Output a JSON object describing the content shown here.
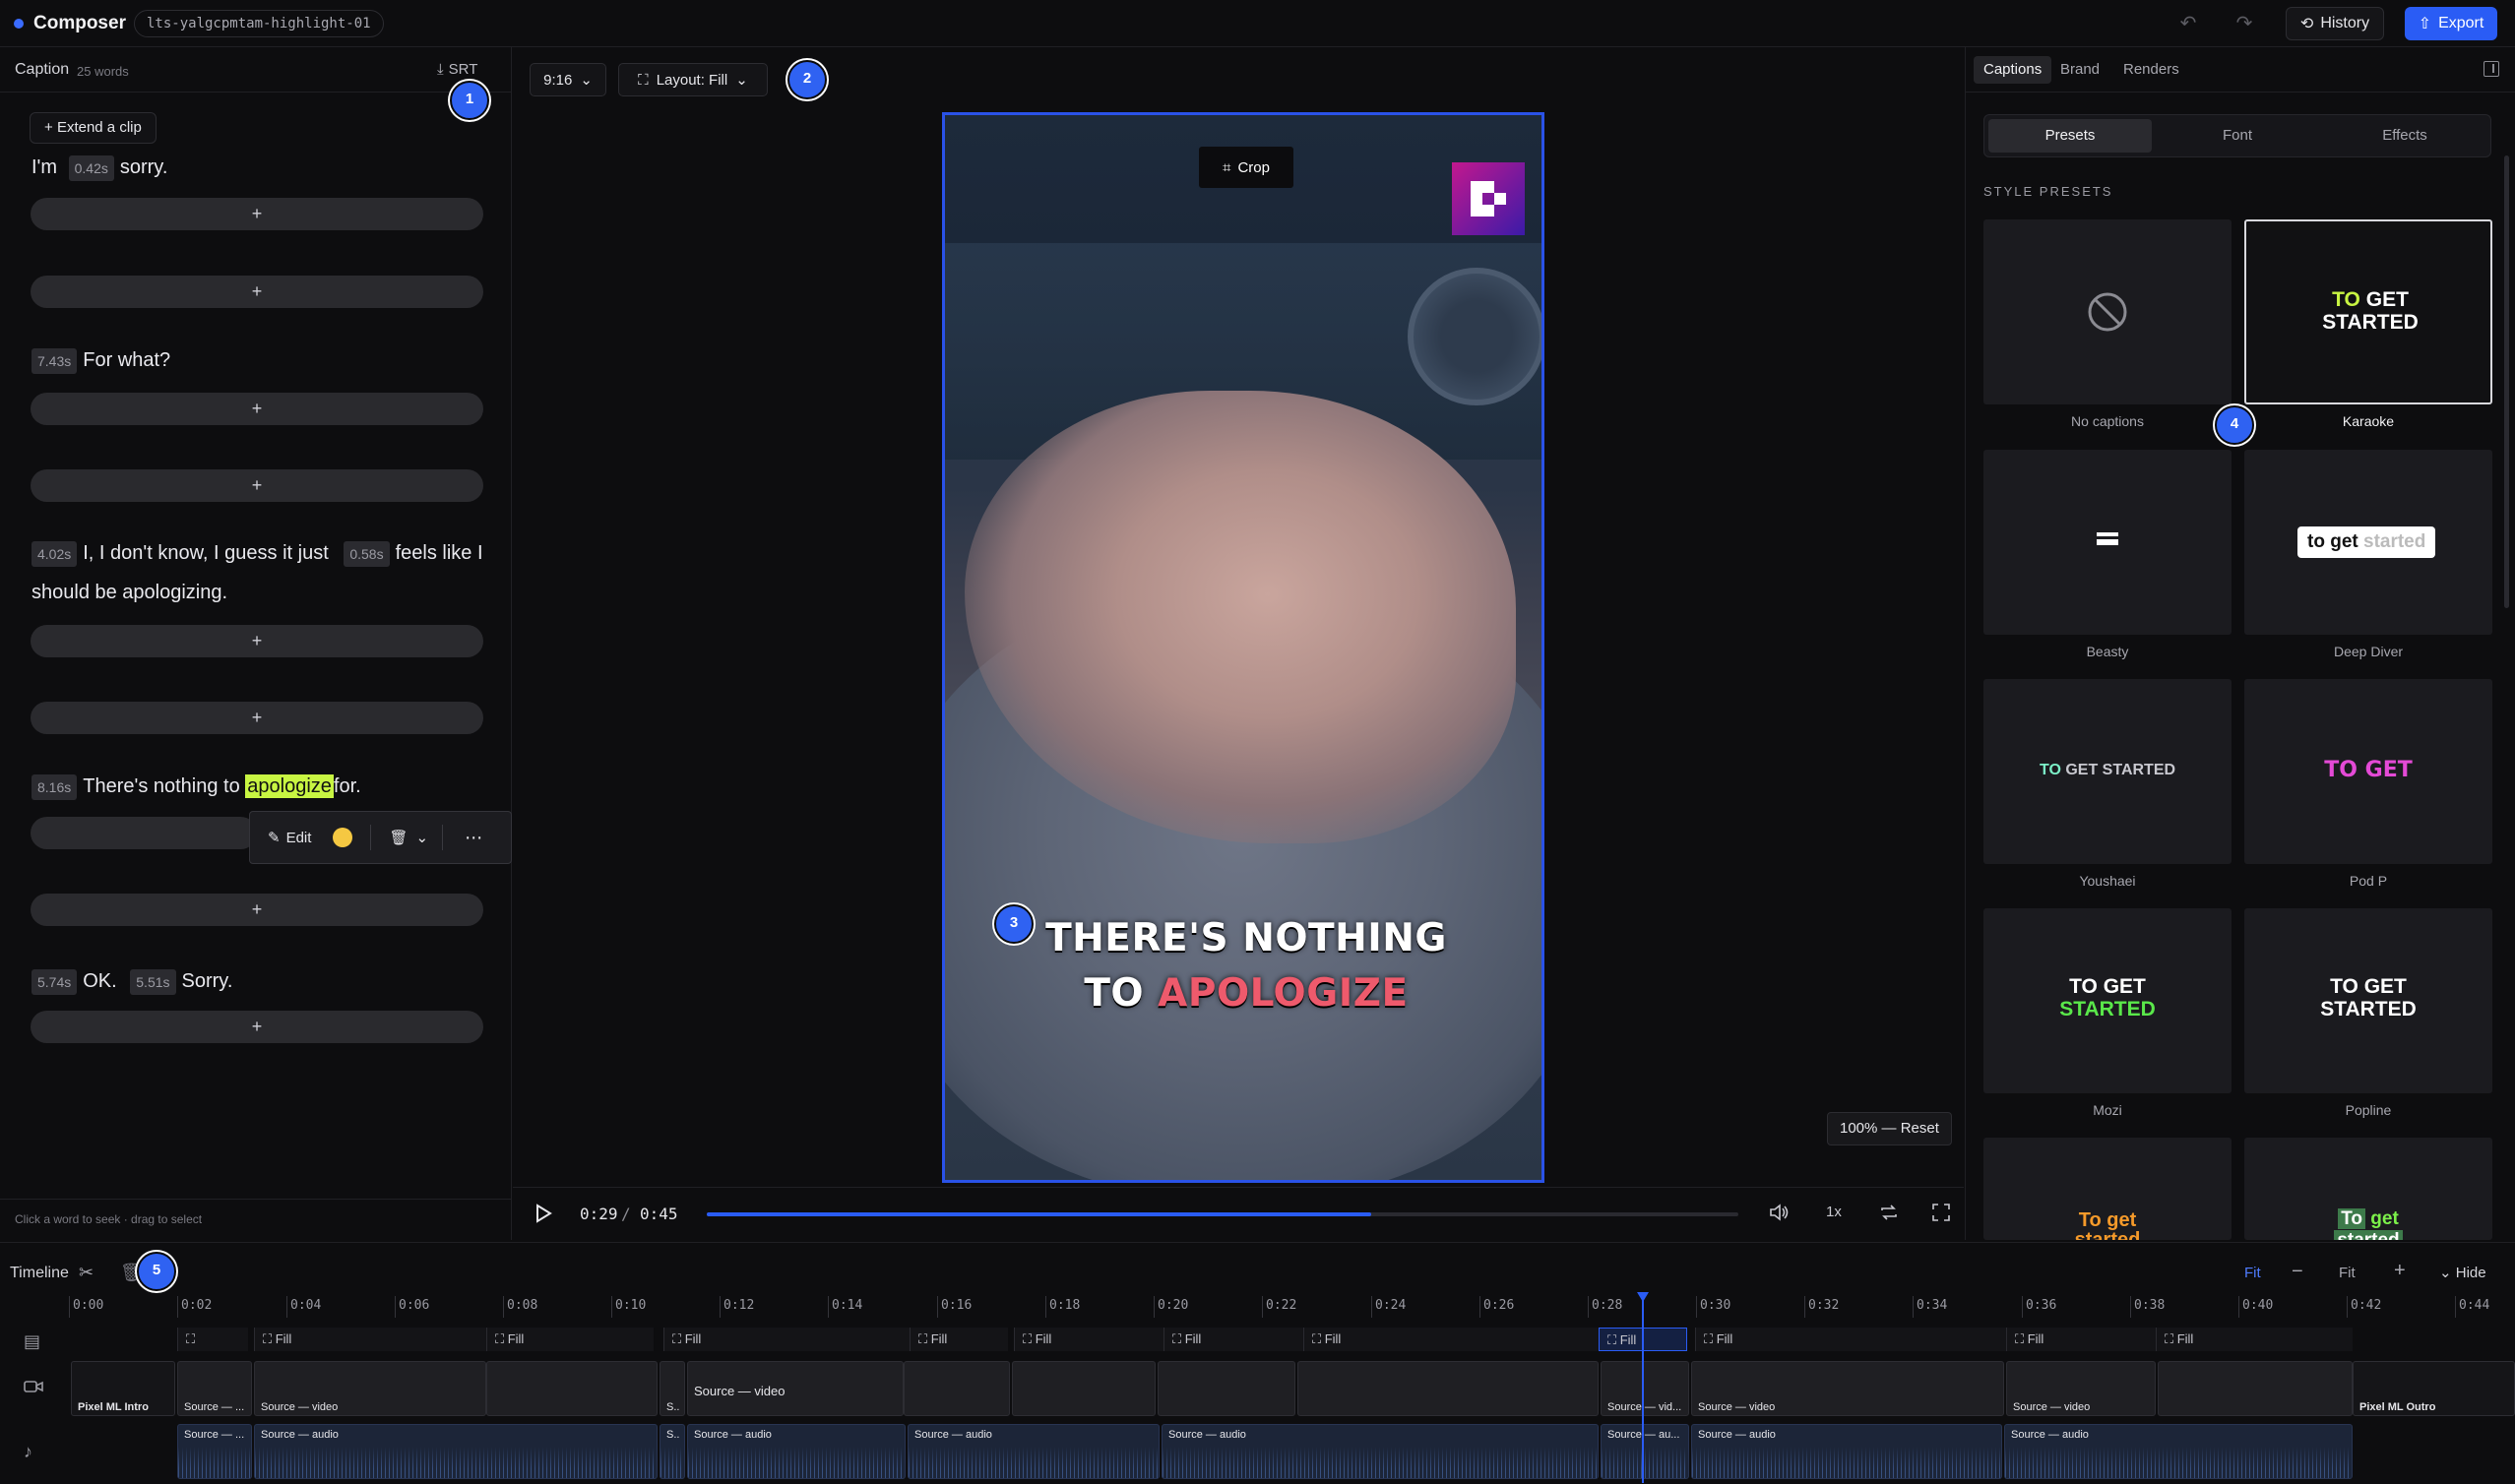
{
  "app": {
    "brand": "Composer",
    "project_id": "lts-yalgcpmtam-highlight-01",
    "history_label": "History",
    "export_label": "Export",
    "accent": "#2a5cf5"
  },
  "caption_panel": {
    "title": "Caption",
    "word_count": "25 words",
    "srt_label": "SRT",
    "extend_label": "Extend a clip",
    "add_symbol": "+",
    "footer_hint": "Click a word to seek · drag to select",
    "lines": [
      {
        "ts1": "0.42s",
        "text_a": "I'm",
        "text_b": "sorry."
      },
      {
        "ts1": "7.43s",
        "text_a": "For what?"
      },
      {
        "ts1": "4.02s",
        "text_a": "I, I don't know, I guess it just",
        "ts2": "0.58s",
        "text_b": "feels like I should be apologizing."
      },
      {
        "ts1": "8.16s",
        "text_a": "There's nothing to",
        "highlight": "apologize",
        "text_b": "for."
      },
      {
        "ts1": "5.74s",
        "text_a": "OK.",
        "ts2": "5.51s",
        "text_b": "Sorry."
      }
    ],
    "word_toolbar": {
      "edit_label": "Edit",
      "color": "#f5c842"
    }
  },
  "stage": {
    "aspect_ratio": "9:16",
    "layout_label": "Layout: Fill",
    "crop_label": "Crop",
    "subtitle_line1": "THERE'S NOTHING",
    "subtitle_line2_a": "TO",
    "subtitle_line2_b": "APOLOGIZE",
    "zoom_reset_label": "100% — Reset",
    "time_current": "0:29",
    "time_separator": "/",
    "time_total": "0:45",
    "progress_fraction": 0.644,
    "speed_label": "1x"
  },
  "style_panel": {
    "tabs": [
      "Captions",
      "Brand",
      "Renders"
    ],
    "active_tab": "Captions",
    "subtabs": [
      "Presets",
      "Font",
      "Effects"
    ],
    "active_subtab": "Presets",
    "section_title": "STYLE PRESETS",
    "presets": [
      {
        "name": "No captions"
      },
      {
        "name": "Karaoke",
        "selected": true,
        "preview_a": "TO",
        "preview_b": "GET",
        "preview_c": "STARTED"
      },
      {
        "name": "Beasty"
      },
      {
        "name": "Deep Diver",
        "preview_a": "to get",
        "preview_b": "started"
      },
      {
        "name": "Youshaei",
        "preview_a": "TO",
        "preview_b": "GET STARTED"
      },
      {
        "name": "Pod P",
        "preview_a": "TO GET"
      },
      {
        "name": "Mozi",
        "preview_a": "TO GET",
        "preview_b": "STARTED"
      },
      {
        "name": "Popline",
        "preview_a": "TO GET",
        "preview_b": "STARTED"
      },
      {
        "name": "",
        "preview_a": "To get",
        "preview_b": "started"
      },
      {
        "name": "",
        "preview_a": "To",
        "preview_b": "get",
        "preview_c": "started"
      }
    ]
  },
  "timeline": {
    "title": "Timeline",
    "fit_label": "Fit",
    "fit_label_2": "Fit",
    "hide_label": "Hide",
    "ticks": [
      "0:00",
      "0:02",
      "0:04",
      "0:06",
      "0:08",
      "0:10",
      "0:12",
      "0:14",
      "0:16",
      "0:18",
      "0:20",
      "0:22",
      "0:24",
      "0:26",
      "0:28",
      "0:30",
      "0:32",
      "0:34",
      "0:36",
      "0:38",
      "0:40",
      "0:42",
      "0:44"
    ],
    "fill_label": "Fill",
    "video_clips": [
      "Pixel ML Intro",
      "Source — ...",
      "Source — video",
      "",
      "S..",
      "Source — video",
      "",
      "",
      "",
      "",
      "Source — vid...",
      "Source — video",
      "Source — video",
      "",
      "Pixel ML Outro"
    ],
    "audio_clips": [
      "Source — ...",
      "Source — audio",
      "S..",
      "Source — audio",
      "Source — audio",
      "Source — audio",
      "Source — au...",
      "Source — audio",
      "Source — audio"
    ]
  },
  "markers": [
    "1",
    "2",
    "3",
    "4",
    "5"
  ]
}
